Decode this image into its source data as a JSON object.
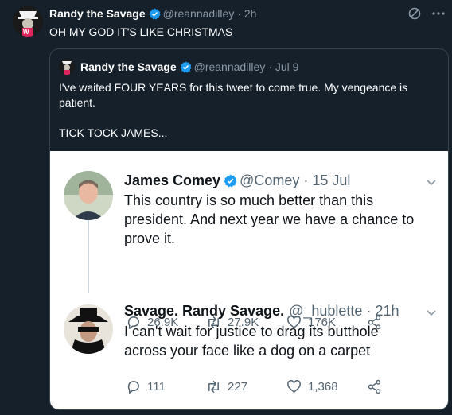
{
  "tweet": {
    "author_name": "Randy the Savage",
    "handle": "@reannadilley",
    "time": "· 2h",
    "text": "OH MY GOD IT'S LIKE CHRISTMAS",
    "menu_icon": "more-dots-icon",
    "tools_icon": "no-sign-icon"
  },
  "quote": {
    "author_name": "Randy the Savage",
    "handle": "@reannadilley",
    "time": "· Jul 9",
    "lines": [
      "I've waited FOUR YEARS for this tweet to come true. My vengeance is",
      "patient."
    ],
    "closing": "TICK TOCK JAMES..."
  },
  "screenshot": {
    "first": {
      "name": "James Comey",
      "handle": "@Comey",
      "time": "· 15 Jul",
      "lines": [
        "This country is so much better than this",
        "president.  And next year we have a chance to",
        "prove it."
      ],
      "replies": "26.9K",
      "retweets": "27.9K",
      "likes": "176K"
    },
    "second": {
      "name": "Savage. Randy Savage.",
      "handle": "@_hublette",
      "time": "· 21h",
      "lines": [
        "I can't wait for justice to drag its butthole",
        "across your face like a dog on a carpet"
      ],
      "replies": "111",
      "retweets": "227",
      "likes": "1,368"
    }
  },
  "colors": {
    "background": "#15202b",
    "verified": "#1d9bf0",
    "muted_text": "#8b98a5",
    "card_border": "#38444d"
  }
}
